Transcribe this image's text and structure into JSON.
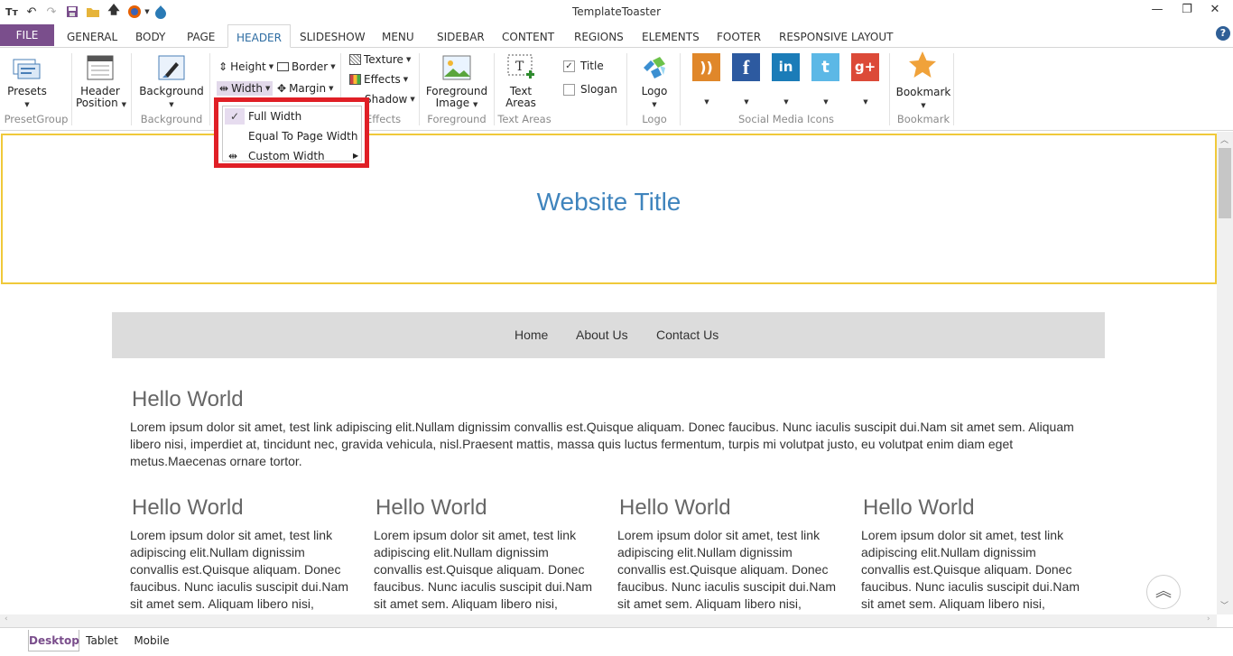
{
  "window": {
    "title": "TemplateToaster"
  },
  "tabs": {
    "file": "FILE",
    "items": [
      "GENERAL",
      "BODY",
      "PAGE",
      "HEADER",
      "SLIDESHOW",
      "MENU",
      "SIDEBAR",
      "CONTENT",
      "REGIONS",
      "ELEMENTS",
      "FOOTER",
      "RESPONSIVE LAYOUT"
    ],
    "active": "HEADER",
    "help": "?"
  },
  "ribbon": {
    "presets": "Presets",
    "preset_group": "PresetGroup",
    "header_position_1": "Header",
    "header_position_2": "Position",
    "background": "Background",
    "background_group": "Background",
    "height": "Height",
    "border": "Border",
    "width": "Width",
    "margin": "Margin",
    "texture": "Texture",
    "effects": "Effects",
    "shadow": "Shadow",
    "effects_group": "Effects",
    "foreground_image_1": "Foreground",
    "foreground_image_2": "Image",
    "foreground_group": "Foreground",
    "text_areas_1": "Text",
    "text_areas_2": "Areas",
    "text_areas_group": "Text Areas",
    "title_check": "Title",
    "slogan_check": "Slogan",
    "logo": "Logo",
    "logo_group": "Logo",
    "social_group": "Social Media Icons",
    "bookmark": "Bookmark",
    "bookmark_group": "Bookmark"
  },
  "width_menu": {
    "items": [
      "Full Width",
      "Equal To Page Width",
      "Custom Width"
    ],
    "checked": "Full Width"
  },
  "page": {
    "site_title": "Website Title",
    "nav": [
      "Home",
      "About Us",
      "Contact Us"
    ],
    "main_heading": "Hello World",
    "main_text_1": " Lorem ipsum dolor sit amet, test link adipiscing elit.Nullam dignissim convallis est.Quisque aliquam. Donec faucibus. Nunc iaculis suscipit dui.Nam sit amet sem. Aliquam",
    "main_text_2": "libero nisi, imperdiet at, tincidunt nec, gravida vehicula, nisl.Praesent mattis, massa quis luctus fermentum, turpis mi volutpat justo, eu volutpat enim diam eget",
    "main_text_3": "metus.Maecenas ornare tortor.",
    "col_heading": "Hello World",
    "col_lines": [
      " Lorem ipsum dolor sit amet, test link",
      "adipiscing elit.Nullam dignissim",
      "convallis est.Quisque aliquam. Donec",
      "faucibus. Nunc iaculis suscipit dui.Nam",
      "sit amet sem. Aliquam libero nisi,"
    ]
  },
  "bottom_tabs": {
    "items": [
      "Desktop",
      "Tablet",
      "Mobile"
    ],
    "active": "Desktop"
  },
  "colors": {
    "accent": "#7a4e8c",
    "title_blue": "#3f84bd",
    "highlight_border": "#e01f26",
    "header_border": "#f0c93a"
  }
}
